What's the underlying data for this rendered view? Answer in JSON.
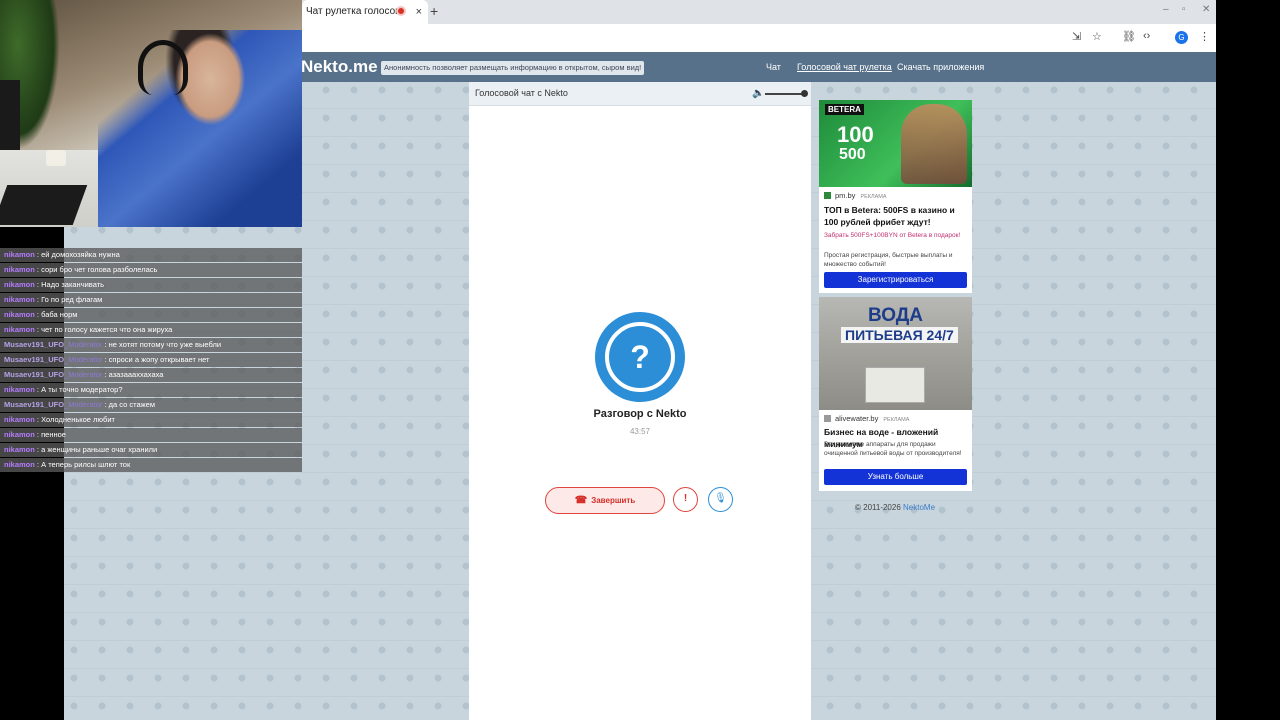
{
  "browser": {
    "tab_title": "Чат рулетка голосов",
    "tab_close": "×",
    "new_tab": "+",
    "profile_initial": "G"
  },
  "site": {
    "logo": "Nekto.me",
    "notice": "Анонимность позволяет размещать информацию в открытом, сыром вид!",
    "nav": [
      "Чат",
      "Голосовой чат рулетка",
      "Скачать приложения"
    ],
    "footer_copy": "© 2011-2026",
    "footer_link": "NektoMe"
  },
  "voice_chat": {
    "header": "Голосовой чат с Nekto",
    "volume_level": 0.9,
    "avatar_glyph": "?",
    "peer_title": "Разговор с Nekto",
    "timer": "43:57",
    "end_label": "Завершить",
    "report_glyph": "!",
    "mic_glyph": "🎙"
  },
  "ads": [
    {
      "image_brand": "BETERA",
      "image_text_1": "100",
      "image_text_2": "500",
      "source": "pm.by",
      "source_tag": "РЕКЛАМА",
      "title": "ТОП в Betera: 500FS в казино и 100 рублей фрибет ждут!",
      "promo": "Забрать 500FS+100BYN от Betera в подарок!",
      "desc": "Простая регистрация, быстрые выплаты и множество событий!",
      "button": "Зарегистрироваться"
    },
    {
      "image_text_1": "ВОДА",
      "image_text_2": "ПИТЬЕВАЯ 24/7",
      "source": "alivewater.by",
      "source_tag": "РЕКЛАМА",
      "title": "Бизнес на воде - вложений минимум",
      "desc": "Вендинговые аппараты для продажи очищенной питьевой воды от производителя!",
      "button": "Узнать больше"
    }
  ],
  "stream_chat": [
    {
      "user": "nikamon",
      "role": "",
      "msg": "ей домохозяйка нужна"
    },
    {
      "user": "nikamon",
      "role": "",
      "msg": "сори бро чет голова разболелась"
    },
    {
      "user": "nikamon",
      "role": "",
      "msg": "Надо заканчивать"
    },
    {
      "user": "nikamon",
      "role": "",
      "msg": "Го по ред флагам"
    },
    {
      "user": "nikamon",
      "role": "",
      "msg": "баба норм"
    },
    {
      "user": "nikamon",
      "role": "",
      "msg": "чет по голосу кажется что она жируха"
    },
    {
      "user": "Musaev191_UFO",
      "role": "_Moderator",
      "msg": "не хотят потому что уже выебли"
    },
    {
      "user": "Musaev191_UFO",
      "role": "_Moderator",
      "msg": "спроси а жопу открывает нет"
    },
    {
      "user": "Musaev191_UFO",
      "role": "_Moderator",
      "msg": "азазаааххахаха"
    },
    {
      "user": "nikamon",
      "role": "",
      "msg": "А ты точно модератор?"
    },
    {
      "user": "Musaev191_UFO",
      "role": "_Moderator",
      "msg": "да со стажем"
    },
    {
      "user": "nikamon",
      "role": "",
      "msg": "Холодненькое любит"
    },
    {
      "user": "nikamon",
      "role": "",
      "msg": "пенное"
    },
    {
      "user": "nikamon",
      "role": "",
      "msg": "а женщины раньше очаг хранили"
    },
    {
      "user": "nikamon",
      "role": "",
      "msg": "А теперь рилсы шлют ток"
    }
  ]
}
